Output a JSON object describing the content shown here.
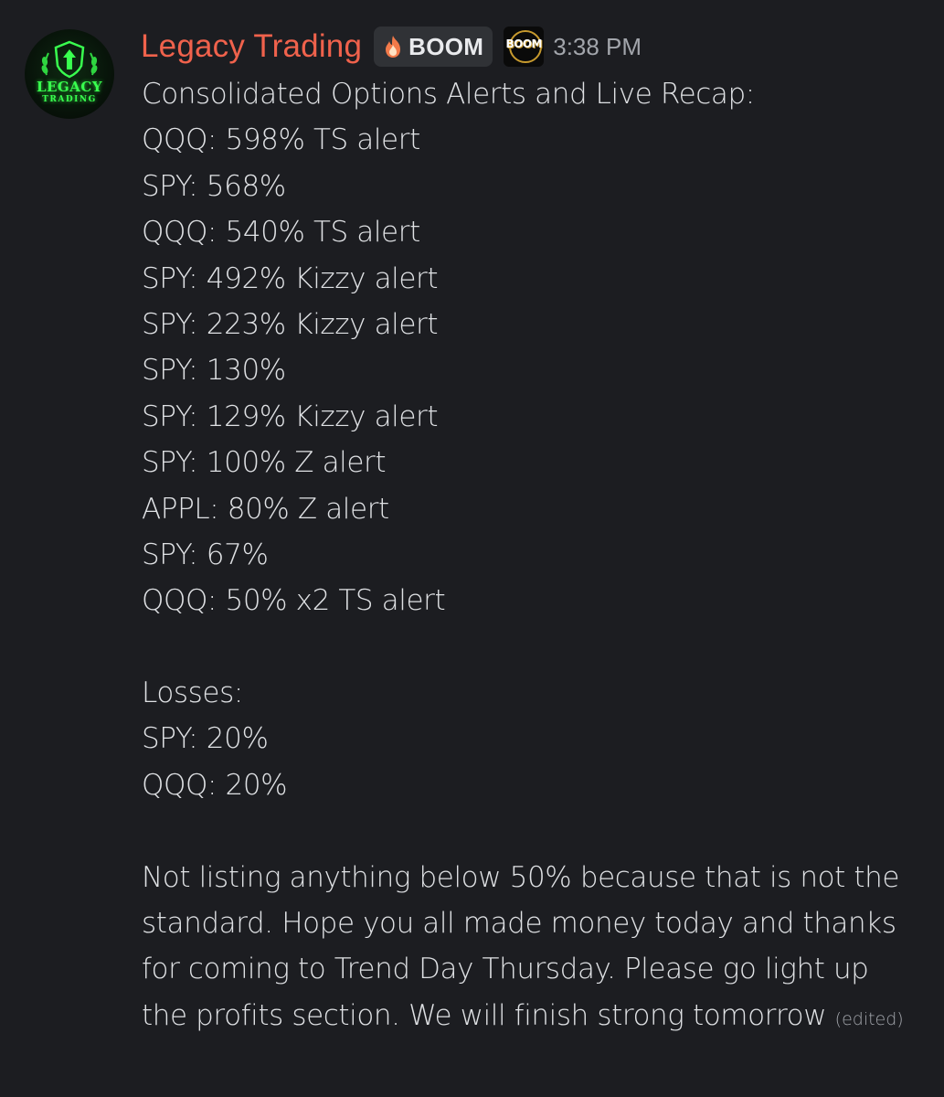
{
  "message": {
    "author": "Legacy Trading",
    "tag": "BOOM",
    "server_icon_text": "BOOM",
    "avatar_text": [
      "LEGACY",
      "TRADING"
    ],
    "timestamp": "3:38 PM",
    "title_line": "Consolidated Options Alerts and Live Recap:",
    "wins": [
      "QQQ: 598% TS alert",
      "SPY: 568%",
      "QQQ: 540% TS alert",
      "SPY: 492% Kizzy alert",
      "SPY: 223% Kizzy alert",
      "SPY: 130%",
      "SPY: 129% Kizzy alert",
      "SPY: 100% Z alert",
      "APPL: 80% Z alert",
      "SPY: 67%",
      "QQQ: 50% x2 TS alert"
    ],
    "losses_heading": "Losses:",
    "losses": [
      "SPY: 20%",
      "QQQ: 20%"
    ],
    "closing_paragraph": "Not listing anything below 50% because that is not the standard. Hope you all made money today and thanks for coming to Trend Day Thursday. Please go light up the profits section. We will finish strong tomorrow",
    "edited_label": "(edited)"
  },
  "colors": {
    "background": "#1c1d21",
    "author": "#f0624c",
    "text": "#dfe1e4",
    "muted": "#a2a5ab",
    "badge_bg": "#303236",
    "avatar_green": "#39ff4f"
  }
}
